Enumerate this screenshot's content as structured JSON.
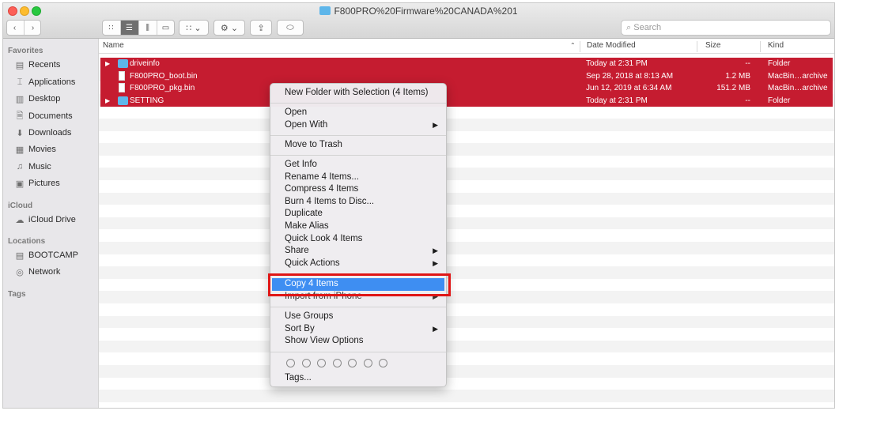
{
  "window": {
    "title": "F800PRO%20Firmware%20CANADA%201"
  },
  "search": {
    "placeholder": "Search"
  },
  "sidebar": {
    "sections": [
      {
        "heading": "Favorites",
        "items": [
          {
            "label": "Recents",
            "icon": "recents-icon"
          },
          {
            "label": "Applications",
            "icon": "applications-icon"
          },
          {
            "label": "Desktop",
            "icon": "desktop-icon"
          },
          {
            "label": "Documents",
            "icon": "documents-icon"
          },
          {
            "label": "Downloads",
            "icon": "downloads-icon"
          },
          {
            "label": "Movies",
            "icon": "movies-icon"
          },
          {
            "label": "Music",
            "icon": "music-icon"
          },
          {
            "label": "Pictures",
            "icon": "pictures-icon"
          }
        ]
      },
      {
        "heading": "iCloud",
        "items": [
          {
            "label": "iCloud Drive",
            "icon": "cloud-icon"
          }
        ]
      },
      {
        "heading": "Locations",
        "items": [
          {
            "label": "BOOTCAMP",
            "icon": "disk-icon"
          },
          {
            "label": "Network",
            "icon": "network-icon"
          }
        ]
      },
      {
        "heading": "Tags",
        "items": []
      }
    ]
  },
  "columns": {
    "name": "Name",
    "date": "Date Modified",
    "size": "Size",
    "kind": "Kind"
  },
  "files": [
    {
      "name": "driveinfo",
      "date": "Today at 2:31 PM",
      "size": "--",
      "kind": "Folder",
      "type": "folder"
    },
    {
      "name": "F800PRO_boot.bin",
      "date": "Sep 28, 2018 at 8:13 AM",
      "size": "1.2 MB",
      "kind": "MacBin…archive",
      "type": "file"
    },
    {
      "name": "F800PRO_pkg.bin",
      "date": "Jun 12, 2019 at 6:34 AM",
      "size": "151.2 MB",
      "kind": "MacBin…archive",
      "type": "file"
    },
    {
      "name": "SETTING",
      "date": "Today at 2:31 PM",
      "size": "--",
      "kind": "Folder",
      "type": "folder"
    }
  ],
  "context_menu": {
    "new_folder": "New Folder with Selection (4 Items)",
    "open": "Open",
    "open_with": "Open With",
    "move_to_trash": "Move to Trash",
    "get_info": "Get Info",
    "rename": "Rename 4 Items...",
    "compress": "Compress 4 Items",
    "burn": "Burn 4 Items to Disc...",
    "duplicate": "Duplicate",
    "make_alias": "Make Alias",
    "quick_look": "Quick Look 4 Items",
    "share": "Share",
    "quick_actions": "Quick Actions",
    "copy": "Copy 4 Items",
    "import_iphone": "Import from iPhone",
    "use_groups": "Use Groups",
    "sort_by": "Sort By",
    "show_view_options": "Show View Options",
    "tags": "Tags..."
  },
  "colors": {
    "selection": "#c51c30",
    "highlight": "#3e8ef2",
    "annotation": "#e01616"
  }
}
